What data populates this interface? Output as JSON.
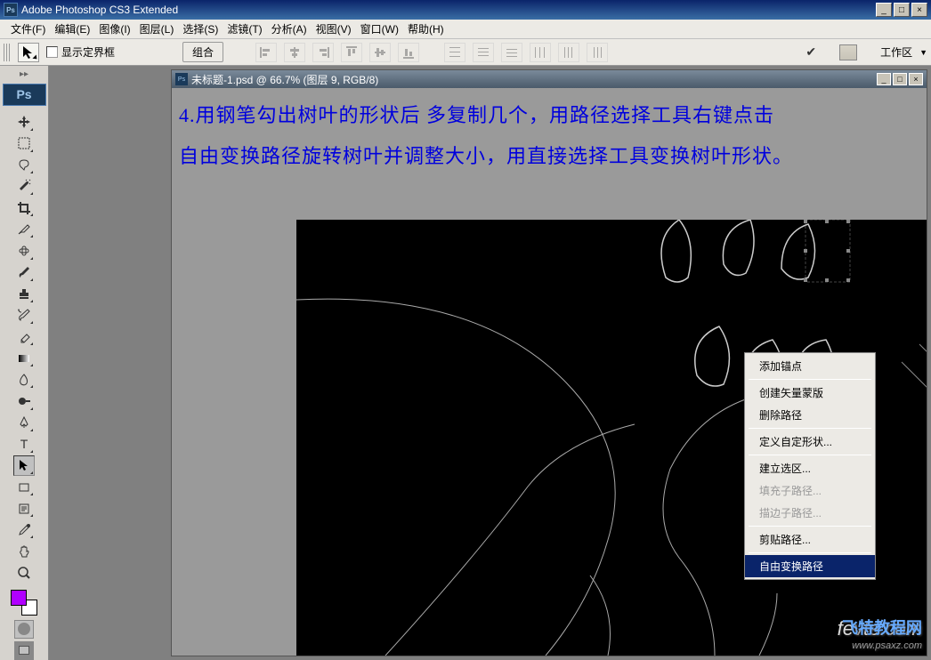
{
  "app": {
    "title": "Adobe Photoshop CS3 Extended",
    "logo": "Ps"
  },
  "menu": {
    "file": "文件(F)",
    "edit": "编辑(E)",
    "image": "图像(I)",
    "layer": "图层(L)",
    "select": "选择(S)",
    "filter": "滤镜(T)",
    "analysis": "分析(A)",
    "view": "视图(V)",
    "window": "窗口(W)",
    "help": "帮助(H)"
  },
  "options": {
    "show_bbox": "显示定界框",
    "group_btn": "组合",
    "workspace": "工作区",
    "workspace_arrow": "▼"
  },
  "document": {
    "title": "未标题-1.psd @ 66.7% (图层 9, RGB/8)"
  },
  "instruction": {
    "text": "4.用钢笔勾出树叶的形状后 多复制几个，用路径选择工具右键点击自由变换路径旋转树叶并调整大小，用直接选择工具变换树叶形状。"
  },
  "context_menu": {
    "add_anchor": "添加锚点",
    "create_mask": "创建矢量蒙版",
    "delete_path": "删除路径",
    "define_shape": "定义自定形状...",
    "make_selection": "建立选区...",
    "fill_subpath": "填充子路径...",
    "stroke_subpath": "描边子路径...",
    "clip_path": "剪贴路径...",
    "free_transform": "自由变换路径"
  },
  "watermark": {
    "main": "fevte.com",
    "cn": "飞特教程网",
    "sub": "www.psaxz.com"
  },
  "colors": {
    "foreground": "#b000ff",
    "background": "#ffffff"
  }
}
